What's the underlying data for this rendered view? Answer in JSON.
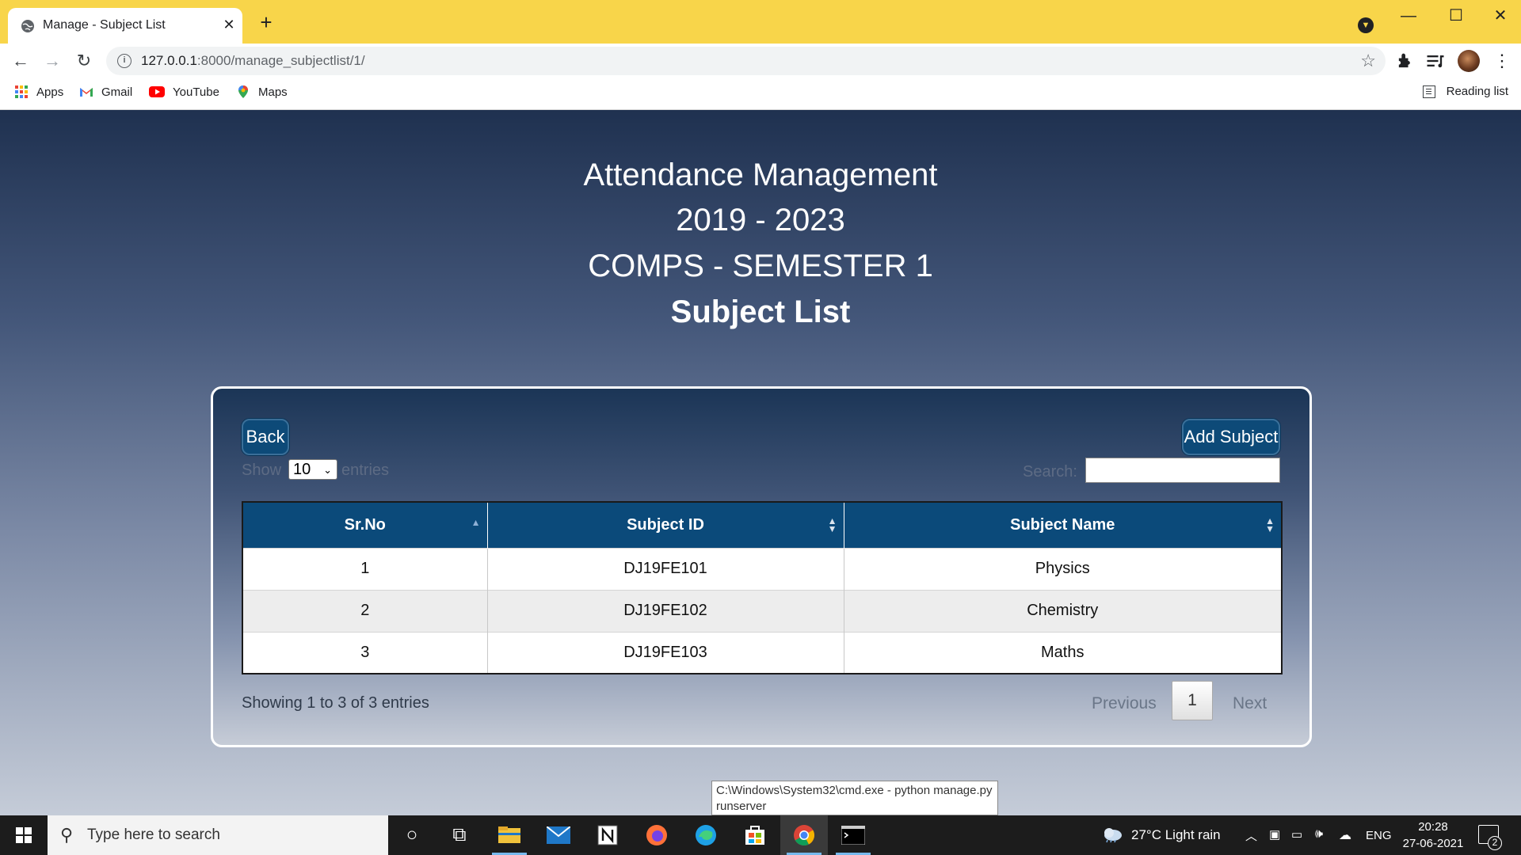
{
  "browser": {
    "tab_title": "Manage - Subject List",
    "url_host": "127.0.0.1",
    "url_path": ":8000/manage_subjectlist/1/",
    "bookmarks": [
      "Apps",
      "Gmail",
      "YouTube",
      "Maps"
    ],
    "reading_list": "Reading list",
    "colors": {
      "tabstrip": "#f8d54a"
    }
  },
  "page": {
    "heading_line1": "Attendance Management",
    "heading_line2": "2019 - 2023",
    "heading_line3": "COMPS - SEMESTER 1",
    "heading_line4": "Subject List",
    "back_label": "Back",
    "add_label": "Add Subject",
    "show_label": "Show",
    "entries_value": "10",
    "entries_label": "entries",
    "search_label": "Search:",
    "search_value": "",
    "table": {
      "headers": [
        "Sr.No",
        "Subject ID",
        "Subject Name"
      ],
      "rows": [
        [
          "1",
          "DJ19FE101",
          "Physics"
        ],
        [
          "2",
          "DJ19FE102",
          "Chemistry"
        ],
        [
          "3",
          "DJ19FE103",
          "Maths"
        ]
      ]
    },
    "info": "Showing 1 to 3 of 3 entries",
    "pagination": {
      "previous": "Previous",
      "page": "1",
      "next": "Next"
    },
    "colors": {
      "header_bg": "#0b4a7a",
      "button_bg": "#0d4a78"
    }
  },
  "tooltip": {
    "line1": "C:\\Windows\\System32\\cmd.exe - python  manage.py",
    "line2": "runserver"
  },
  "taskbar": {
    "search_placeholder": "Type here to search",
    "weather": "27°C  Light rain",
    "language": "ENG",
    "time": "20:28",
    "date": "27-06-2021",
    "notification_count": "2"
  }
}
